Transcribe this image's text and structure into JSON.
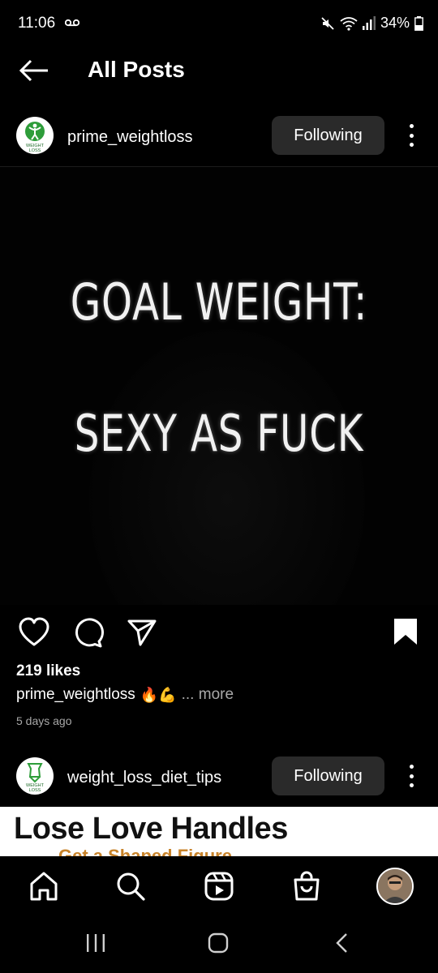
{
  "status_bar": {
    "time": "11:06",
    "battery": "34%",
    "icons": [
      "voicemail-icon",
      "mute-icon",
      "wifi-icon",
      "signal-icon",
      "battery-icon"
    ]
  },
  "header": {
    "title": "All Posts",
    "back_icon": "arrow-left-icon"
  },
  "posts": [
    {
      "username": "prime_weightloss",
      "avatar_text": [
        "WEIGHT",
        "LOSS"
      ],
      "follow_label": "Following",
      "image_text": [
        "GOAL WEIGHT:",
        "SEXY AS FUCK"
      ],
      "likes": "219 likes",
      "caption_user": "prime_weightloss",
      "caption_emojis": "🔥💪",
      "caption_more": "... more",
      "timestamp": "5 days ago"
    },
    {
      "username": "weight_loss_diet_tips",
      "avatar_text": [
        "WEIGHT",
        "LOSS"
      ],
      "follow_label": "Following",
      "image_title": "Lose Love Handles",
      "image_subtitle": "Get a Shaped Figure"
    }
  ],
  "bottom_nav": [
    "home-icon",
    "search-icon",
    "reels-icon",
    "shop-icon",
    "profile-avatar"
  ],
  "system_nav": [
    "recents-icon",
    "home-button-icon",
    "back-icon"
  ],
  "colors": {
    "background": "#000000",
    "button": "#2a2a2a",
    "secondary_text": "#a8a8a8",
    "brand_green": "#2e9d3a"
  }
}
